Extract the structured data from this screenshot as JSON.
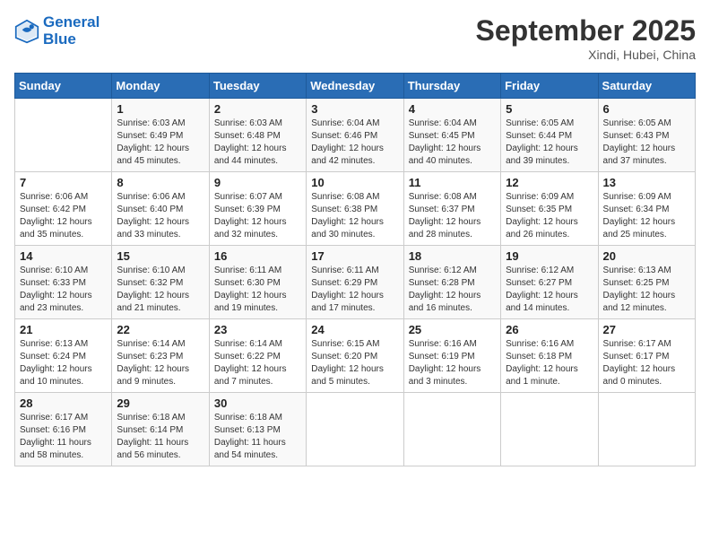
{
  "header": {
    "logo_line1": "General",
    "logo_line2": "Blue",
    "month": "September 2025",
    "location": "Xindi, Hubei, China"
  },
  "days_of_week": [
    "Sunday",
    "Monday",
    "Tuesday",
    "Wednesday",
    "Thursday",
    "Friday",
    "Saturday"
  ],
  "weeks": [
    [
      {
        "day": "",
        "info": ""
      },
      {
        "day": "1",
        "info": "Sunrise: 6:03 AM\nSunset: 6:49 PM\nDaylight: 12 hours\nand 45 minutes."
      },
      {
        "day": "2",
        "info": "Sunrise: 6:03 AM\nSunset: 6:48 PM\nDaylight: 12 hours\nand 44 minutes."
      },
      {
        "day": "3",
        "info": "Sunrise: 6:04 AM\nSunset: 6:46 PM\nDaylight: 12 hours\nand 42 minutes."
      },
      {
        "day": "4",
        "info": "Sunrise: 6:04 AM\nSunset: 6:45 PM\nDaylight: 12 hours\nand 40 minutes."
      },
      {
        "day": "5",
        "info": "Sunrise: 6:05 AM\nSunset: 6:44 PM\nDaylight: 12 hours\nand 39 minutes."
      },
      {
        "day": "6",
        "info": "Sunrise: 6:05 AM\nSunset: 6:43 PM\nDaylight: 12 hours\nand 37 minutes."
      }
    ],
    [
      {
        "day": "7",
        "info": "Sunrise: 6:06 AM\nSunset: 6:42 PM\nDaylight: 12 hours\nand 35 minutes."
      },
      {
        "day": "8",
        "info": "Sunrise: 6:06 AM\nSunset: 6:40 PM\nDaylight: 12 hours\nand 33 minutes."
      },
      {
        "day": "9",
        "info": "Sunrise: 6:07 AM\nSunset: 6:39 PM\nDaylight: 12 hours\nand 32 minutes."
      },
      {
        "day": "10",
        "info": "Sunrise: 6:08 AM\nSunset: 6:38 PM\nDaylight: 12 hours\nand 30 minutes."
      },
      {
        "day": "11",
        "info": "Sunrise: 6:08 AM\nSunset: 6:37 PM\nDaylight: 12 hours\nand 28 minutes."
      },
      {
        "day": "12",
        "info": "Sunrise: 6:09 AM\nSunset: 6:35 PM\nDaylight: 12 hours\nand 26 minutes."
      },
      {
        "day": "13",
        "info": "Sunrise: 6:09 AM\nSunset: 6:34 PM\nDaylight: 12 hours\nand 25 minutes."
      }
    ],
    [
      {
        "day": "14",
        "info": "Sunrise: 6:10 AM\nSunset: 6:33 PM\nDaylight: 12 hours\nand 23 minutes."
      },
      {
        "day": "15",
        "info": "Sunrise: 6:10 AM\nSunset: 6:32 PM\nDaylight: 12 hours\nand 21 minutes."
      },
      {
        "day": "16",
        "info": "Sunrise: 6:11 AM\nSunset: 6:30 PM\nDaylight: 12 hours\nand 19 minutes."
      },
      {
        "day": "17",
        "info": "Sunrise: 6:11 AM\nSunset: 6:29 PM\nDaylight: 12 hours\nand 17 minutes."
      },
      {
        "day": "18",
        "info": "Sunrise: 6:12 AM\nSunset: 6:28 PM\nDaylight: 12 hours\nand 16 minutes."
      },
      {
        "day": "19",
        "info": "Sunrise: 6:12 AM\nSunset: 6:27 PM\nDaylight: 12 hours\nand 14 minutes."
      },
      {
        "day": "20",
        "info": "Sunrise: 6:13 AM\nSunset: 6:25 PM\nDaylight: 12 hours\nand 12 minutes."
      }
    ],
    [
      {
        "day": "21",
        "info": "Sunrise: 6:13 AM\nSunset: 6:24 PM\nDaylight: 12 hours\nand 10 minutes."
      },
      {
        "day": "22",
        "info": "Sunrise: 6:14 AM\nSunset: 6:23 PM\nDaylight: 12 hours\nand 9 minutes."
      },
      {
        "day": "23",
        "info": "Sunrise: 6:14 AM\nSunset: 6:22 PM\nDaylight: 12 hours\nand 7 minutes."
      },
      {
        "day": "24",
        "info": "Sunrise: 6:15 AM\nSunset: 6:20 PM\nDaylight: 12 hours\nand 5 minutes."
      },
      {
        "day": "25",
        "info": "Sunrise: 6:16 AM\nSunset: 6:19 PM\nDaylight: 12 hours\nand 3 minutes."
      },
      {
        "day": "26",
        "info": "Sunrise: 6:16 AM\nSunset: 6:18 PM\nDaylight: 12 hours\nand 1 minute."
      },
      {
        "day": "27",
        "info": "Sunrise: 6:17 AM\nSunset: 6:17 PM\nDaylight: 12 hours\nand 0 minutes."
      }
    ],
    [
      {
        "day": "28",
        "info": "Sunrise: 6:17 AM\nSunset: 6:16 PM\nDaylight: 11 hours\nand 58 minutes."
      },
      {
        "day": "29",
        "info": "Sunrise: 6:18 AM\nSunset: 6:14 PM\nDaylight: 11 hours\nand 56 minutes."
      },
      {
        "day": "30",
        "info": "Sunrise: 6:18 AM\nSunset: 6:13 PM\nDaylight: 11 hours\nand 54 minutes."
      },
      {
        "day": "",
        "info": ""
      },
      {
        "day": "",
        "info": ""
      },
      {
        "day": "",
        "info": ""
      },
      {
        "day": "",
        "info": ""
      }
    ]
  ]
}
